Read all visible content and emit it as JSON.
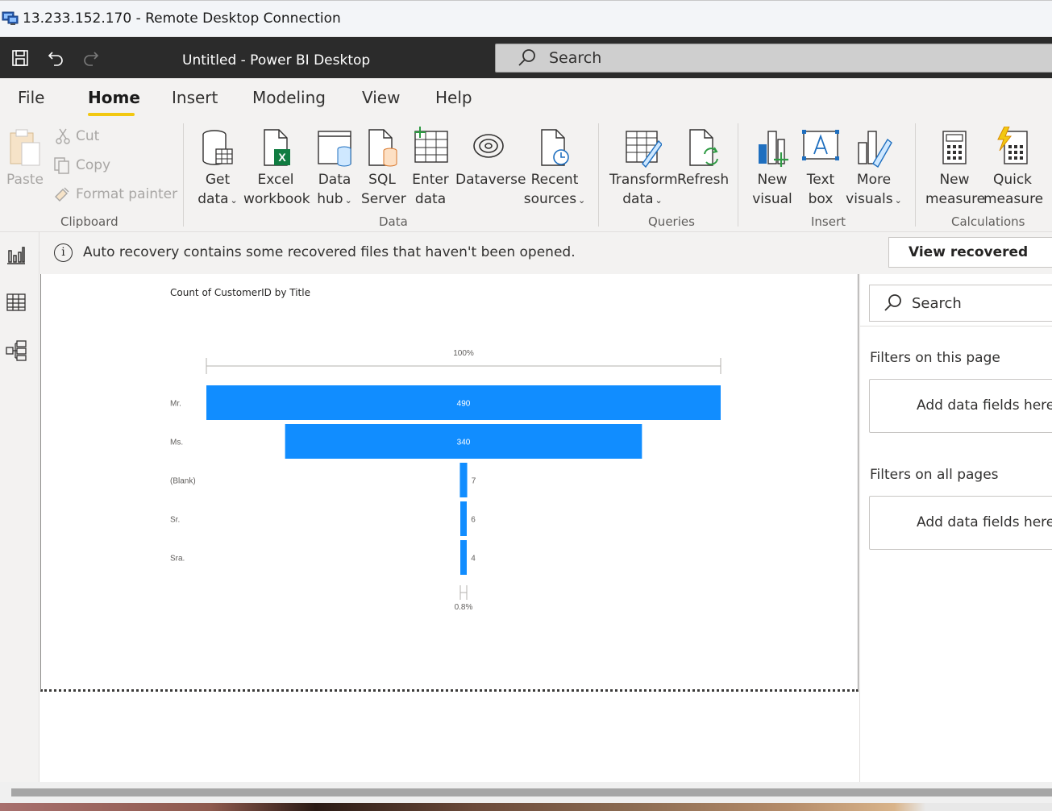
{
  "rdp": {
    "title": "13.233.152.170 - Remote Desktop Connection"
  },
  "app": {
    "doc_title": "Untitled - Power BI Desktop",
    "search_placeholder": "Search"
  },
  "menu": {
    "tabs": [
      "File",
      "Home",
      "Insert",
      "Modeling",
      "View",
      "Help"
    ],
    "active": "Home"
  },
  "ribbon": {
    "clipboard": {
      "paste": "Paste",
      "cut": "Cut",
      "copy": "Copy",
      "format_painter": "Format painter",
      "label": "Clipboard"
    },
    "data": {
      "get_data": [
        "Get",
        "data"
      ],
      "excel": [
        "Excel",
        "workbook"
      ],
      "data_hub": [
        "Data",
        "hub"
      ],
      "sql": [
        "SQL",
        "Server"
      ],
      "enter": [
        "Enter",
        "data"
      ],
      "dataverse": [
        "Dataverse"
      ],
      "recent": [
        "Recent",
        "sources"
      ],
      "label": "Data"
    },
    "queries": {
      "transform": [
        "Transform",
        "data"
      ],
      "refresh": [
        "Refresh"
      ],
      "label": "Queries"
    },
    "insert": {
      "new_visual": [
        "New",
        "visual"
      ],
      "text_box": [
        "Text",
        "box"
      ],
      "more_visuals": [
        "More",
        "visuals"
      ],
      "label": "Insert"
    },
    "calculations": {
      "new_measure": [
        "New",
        "measure"
      ],
      "quick_measure": [
        "Quick",
        "measure"
      ],
      "label": "Calculations"
    }
  },
  "infobar": {
    "message": "Auto recovery contains some recovered files that haven't been opened.",
    "button": "View recovered files"
  },
  "filters": {
    "search_placeholder": "Search",
    "on_this_page": "Filters on this page",
    "on_all_pages": "Filters on all pages",
    "add_fields": "Add data fields here"
  },
  "chart_data": {
    "type": "funnel",
    "title": "Count of CustomerID by Title",
    "categories": [
      "Mr.",
      "Ms.",
      "(Blank)",
      "Sr.",
      "Sra."
    ],
    "values": [
      490,
      340,
      7,
      6,
      4
    ],
    "top_label": "100%",
    "bottom_label": "0.8%",
    "bar_color": "#118dff"
  },
  "colors": {
    "accent": "#f2c811",
    "bar": "#118dff",
    "title_bar": "#2b2b2b"
  }
}
